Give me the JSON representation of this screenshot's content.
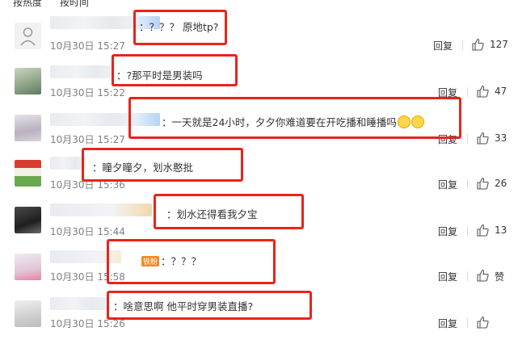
{
  "sort": {
    "hot": "按热度",
    "time": "按时间"
  },
  "action": {
    "reply": "回复"
  },
  "comments": [
    {
      "text": "：？？？ 原地tp?",
      "time": "10月30日 15:27",
      "likes": "127"
    },
    {
      "text": "：?那平时是男装吗",
      "time": "10月30日 15:22",
      "likes": "47"
    },
    {
      "text": "：一天就是24小时，夕夕你难道要在开吃播和睡播吗",
      "time": "10月30日 15:27",
      "likes": "33"
    },
    {
      "text": "：瞳夕瞳夕，划水憨批",
      "time": "10月30日 15:36",
      "likes": "26"
    },
    {
      "text": "：划水还得看我夕宝",
      "time": "10月30日 15:44",
      "likes": "13"
    },
    {
      "text": "：？？？",
      "time": "10月30日 15:58",
      "likes": "赞",
      "badge": "铁粉"
    },
    {
      "text": "：啥意思啊   他平时穿男装直播?",
      "time": "10月30日 15:26",
      "likes": ""
    }
  ]
}
